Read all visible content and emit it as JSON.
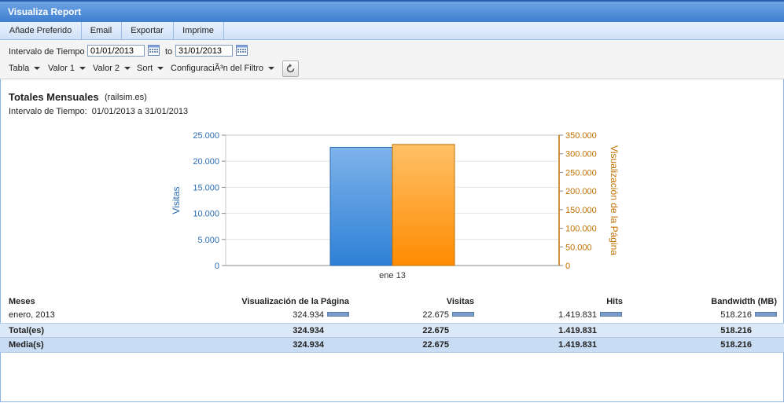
{
  "window": {
    "title": "Visualiza Report"
  },
  "toolbar": {
    "favorite": "Añade Preferido",
    "email": "Email",
    "export": "Exportar",
    "print": "Imprime"
  },
  "filters": {
    "interval_label": "Intervalo de Tiempo",
    "from": "01/01/2013",
    "to_label": "to",
    "to": "31/01/2013",
    "table": "Tabla",
    "value1": "Valor 1",
    "value2": "Valor 2",
    "sort": "Sort",
    "filter_config": "ConfiguraciÃ³n del Filtro"
  },
  "report": {
    "title": "Totales Mensuales",
    "site": "(railsim.es)",
    "period_label": "Intervalo de Tiempo:",
    "period_value": "01/01/2013 a 31/01/2013"
  },
  "chart_data": {
    "type": "bar",
    "categories": [
      "ene 13"
    ],
    "series": [
      {
        "name": "Visitas",
        "values": [
          22675
        ],
        "axis": "left",
        "color": "#3d8ede"
      },
      {
        "name": "Visualización de la Página",
        "values": [
          324934
        ],
        "axis": "right",
        "color": "#ff9a1f"
      }
    ],
    "ylabel": "Visitas",
    "ylim": [
      0,
      25000
    ],
    "yticks": [
      "0",
      "5.000",
      "10.000",
      "15.000",
      "20.000",
      "25.000"
    ],
    "y2label": "Visualización de la Página",
    "y2lim": [
      0,
      350000
    ],
    "y2ticks": [
      "0",
      "50.000",
      "100.000",
      "150.000",
      "200.000",
      "250.000",
      "300.000",
      "350.000"
    ],
    "colors": {
      "left_axis": "#2c6cb4",
      "right_axis": "#c07000"
    },
    "grid": true
  },
  "table": {
    "headers": [
      "Meses",
      "Visualización de la Página",
      "Visitas",
      "Hits",
      "Bandwidth (MB)"
    ],
    "rows": [
      [
        "enero, 2013",
        "324.934",
        "22.675",
        "1.419.831",
        "518.216"
      ]
    ],
    "total": [
      "Total(es)",
      "324.934",
      "22.675",
      "1.419.831",
      "518.216"
    ],
    "average": [
      "Media(s)",
      "324.934",
      "22.675",
      "1.419.831",
      "518.216"
    ]
  }
}
